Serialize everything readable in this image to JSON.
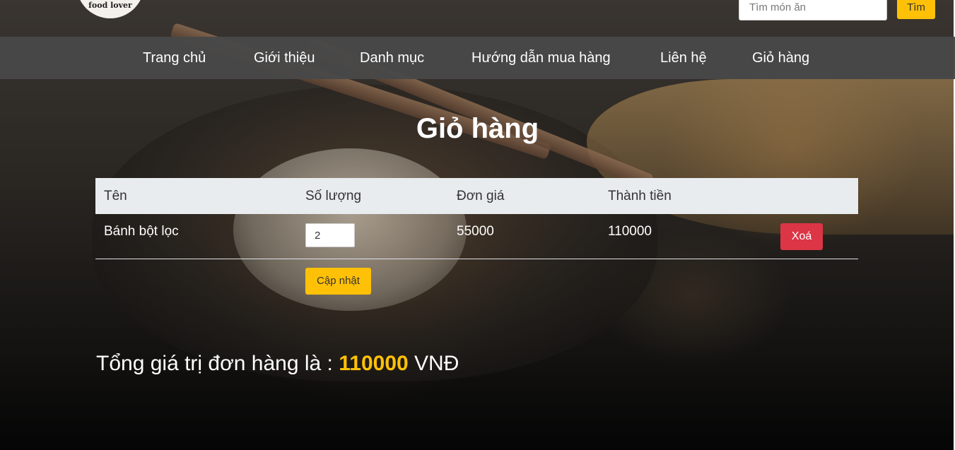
{
  "header": {
    "logo_text": "food lover",
    "search_placeholder": "Tìm món ăn",
    "search_button": "Tìm"
  },
  "nav": {
    "items": [
      {
        "label": "Trang chủ"
      },
      {
        "label": "Giới thiệu"
      },
      {
        "label": "Danh mục"
      },
      {
        "label": "Hướng dẫn mua hàng"
      },
      {
        "label": "Liên hệ"
      },
      {
        "label": "Giỏ hàng"
      }
    ]
  },
  "page": {
    "title": "Giỏ hàng"
  },
  "cart": {
    "columns": [
      "Tên",
      "Số lượng",
      "Đơn giá",
      "Thành tiền"
    ],
    "rows": [
      {
        "name": "Bánh bột lọc",
        "quantity": "2",
        "unit_price": "55000",
        "subtotal": "110000",
        "delete_label": "Xoá"
      }
    ],
    "update_label": "Cập nhật"
  },
  "total": {
    "label": "Tổng giá trị đơn hàng là :",
    "amount": "110000",
    "currency": "VNĐ"
  },
  "colors": {
    "accent": "#ffc107",
    "danger": "#dc3545",
    "nav_bg": "#484848",
    "table_header_bg": "#e9ecef"
  }
}
